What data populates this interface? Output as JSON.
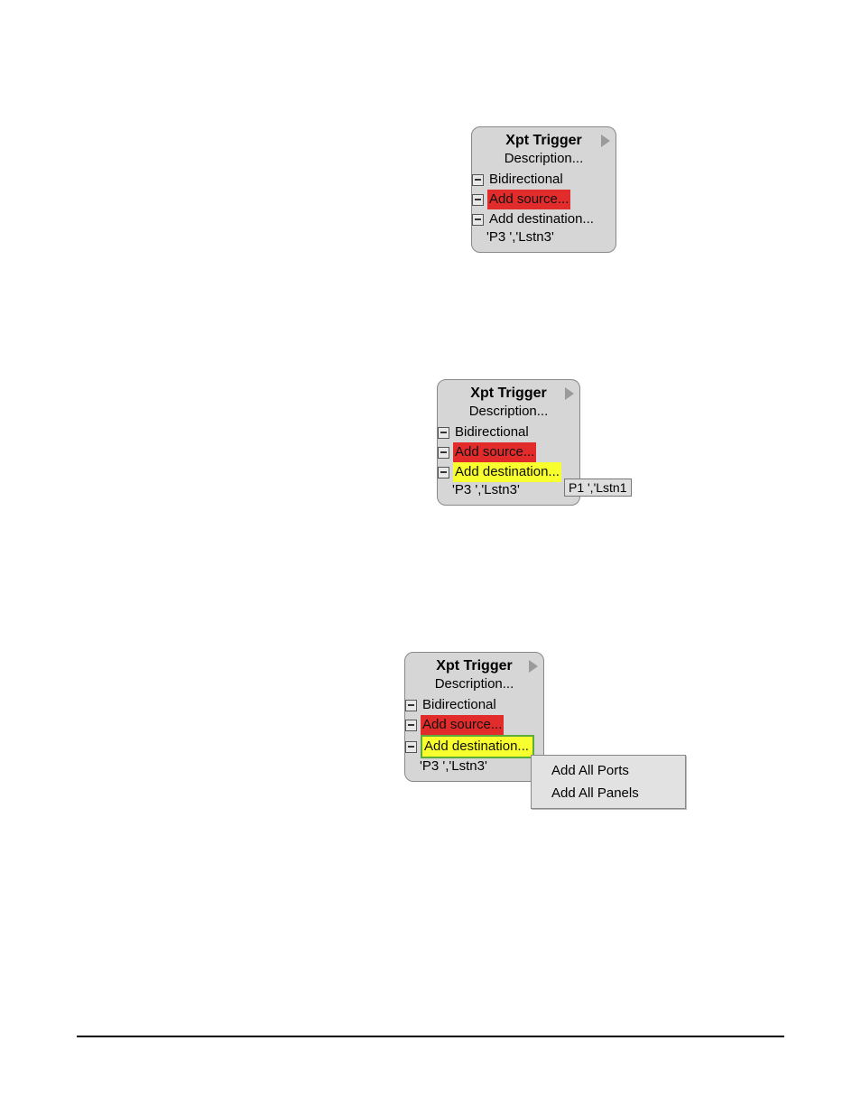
{
  "box1": {
    "title": "Xpt Trigger",
    "desc": "Description...",
    "bidirectional": "Bidirectional",
    "add_source": "Add source...",
    "add_destination": "Add destination...",
    "sub": "'P3   ','Lstn3'"
  },
  "box2": {
    "title": "Xpt Trigger",
    "desc": "Description...",
    "bidirectional": "Bidirectional",
    "add_source": "Add source...",
    "add_destination": "Add destination...",
    "sub": "'P3   ','Lstn3'",
    "tooltip": "P1   ','Lstn1"
  },
  "box3": {
    "title": "Xpt Trigger",
    "desc": "Description...",
    "bidirectional": "Bidirectional",
    "add_source": "Add source...",
    "add_destination": "Add destination...",
    "sub": "'P3   ','Lstn3'"
  },
  "menu": {
    "item1": "Add All Ports",
    "item2": "Add All Panels"
  }
}
